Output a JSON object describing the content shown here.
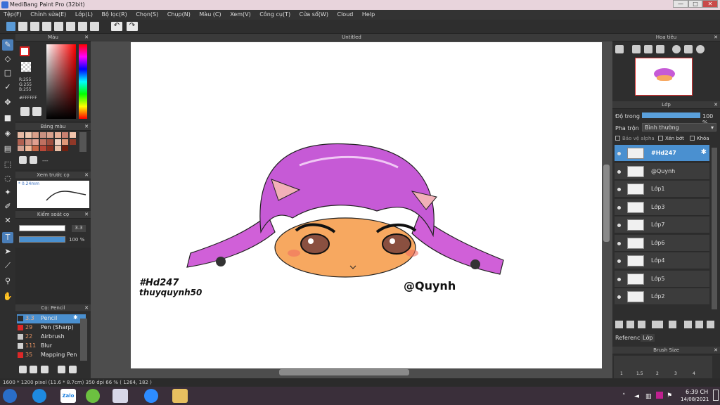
{
  "app": {
    "title": "MediBang Paint Pro (32bit)"
  },
  "window": {
    "minimize": "—",
    "maximize": "□",
    "close": "✕"
  },
  "menu": [
    "Tệp(F)",
    "Chỉnh sửa(E)",
    "Lớp(L)",
    "Bộ lọc(R)",
    "Chọn(S)",
    "Chụp(N)",
    "Màu (C)",
    "Xem(V)",
    "Công cụ(T)",
    "Cửa sổ(W)",
    "Cloud",
    "Help"
  ],
  "document": {
    "tab": "Untitled"
  },
  "color_panel": {
    "title": "Màu",
    "r": "R:255",
    "g": "G:255",
    "b": "B:255",
    "hex": "#FFFFFF"
  },
  "palette_panel": {
    "title": "Bảng màu",
    "swatches": [
      "#e7b9a3",
      "#f0c8b0",
      "#dba08a",
      "#c99080",
      "#d8a08c",
      "#e8b098",
      "#c88070",
      "#f2c4ac",
      "#b06050",
      "#d09080",
      "#e0a090",
      "#c07060",
      "#a05040",
      "#f0d0c0",
      "#e09878",
      "#903828",
      "#d4a090",
      "#f0b898",
      "#c86848",
      "#b84838",
      "#8a3020",
      "#e8c0a8",
      "#702010"
    ],
    "dash": "---"
  },
  "preview_panel": {
    "title": "Xem trước cọ",
    "size": "* 0.24mm"
  },
  "control_panel": {
    "title": "Kiểm soát cọ",
    "size": "3.3",
    "opacity": "100 %",
    "opacity_value": 1.0
  },
  "brush_panel": {
    "title": "Cọ: Pencil",
    "items": [
      {
        "size": "3.3",
        "name": "Pencil",
        "color": "#2a2a2a",
        "selected": true
      },
      {
        "size": "29",
        "name": "Pen (Sharp)",
        "color": "#dc2828",
        "selected": false
      },
      {
        "size": "22",
        "name": "Airbrush",
        "color": "#c8c8c8",
        "selected": false
      },
      {
        "size": "111",
        "name": "Blur",
        "color": "#d2d2d2",
        "selected": false
      },
      {
        "size": "35",
        "name": "Mapping Pen",
        "color": "#dc2828",
        "selected": false
      }
    ]
  },
  "canvas": {
    "text1": "#Hd247",
    "text2": "thuyquynh50",
    "text3": "@Quynh"
  },
  "navigator": {
    "title": "Hoa tiêu"
  },
  "layers_panel": {
    "title": "Lớp",
    "opacity_label": "Độ trong",
    "opacity_value": "100 %",
    "opacity_fraction": 1.0,
    "blend_label": "Pha trộn",
    "blend_value": "Bình thường",
    "alpha_label": "Bảo vệ alpha",
    "clip_label": "Xén bớt",
    "lock_label": "Khóa",
    "layers": [
      {
        "name": "#Hd247",
        "selected": true
      },
      {
        "name": "@Quynh",
        "selected": false
      },
      {
        "name": "Lớp1",
        "selected": false
      },
      {
        "name": "Lớp3",
        "selected": false
      },
      {
        "name": "Lớp7",
        "selected": false
      },
      {
        "name": "Lớp6",
        "selected": false
      },
      {
        "name": "Lớp4",
        "selected": false
      },
      {
        "name": "Lớp5",
        "selected": false
      },
      {
        "name": "Lớp2",
        "selected": false
      }
    ],
    "tabs": [
      "Reference",
      "Lớp"
    ]
  },
  "brush_size_panel": {
    "title": "Brush Size",
    "values": [
      "1",
      "1.5",
      "2",
      "3",
      "4"
    ]
  },
  "status": {
    "text": "1600 * 1200 pixel  (11.6 * 8.7cm)  350 dpi  66 %  ( 1264, 182 )"
  },
  "taskbar": {
    "time": "6:39 CH",
    "date": "14/08/2021",
    "zalo": "Zalo"
  }
}
